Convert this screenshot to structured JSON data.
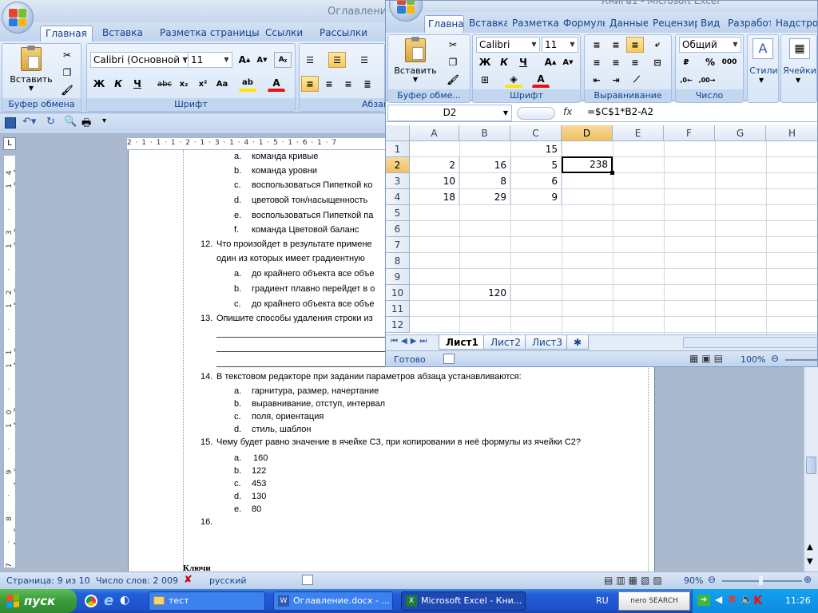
{
  "word": {
    "title": "Оглавление",
    "tabs": [
      "Главная",
      "Вставка",
      "Разметка страницы",
      "Ссылки",
      "Рассылки"
    ],
    "font_name": "Calibri (Основной те",
    "font_size": "11",
    "paste_label": "Вставить",
    "groups": {
      "clipboard": "Буфер обмена",
      "font": "Шрифт",
      "paragraph": "Абзац"
    },
    "ruler_h": "2 · 1 · 1 · 1 · 2 · 1 · 3 · 1 · 4 · 1 · 5 · 1 · 6 · 1 · 7",
    "ruler_v": "7 · 8 · 9 · 10 · 11 · 12 · 13 · 14 · 15 · 16 · 17 · 18 · 19 · 20 · 21",
    "doc": {
      "lines_top": [
        {
          "m": "a.",
          "t": "команда кривые"
        },
        {
          "m": "b.",
          "t": "команда уровни"
        },
        {
          "m": "c.",
          "t": "воспользоваться Пипеткой ко"
        },
        {
          "m": "d.",
          "t": "цветовой тон/насыщенность"
        },
        {
          "m": "e.",
          "t": "воспользоваться Пипеткой па"
        },
        {
          "m": "f.",
          "t": "команда Цветовой баланс"
        }
      ],
      "q12": "12.",
      "q12_text": "Что произойдет в результате примене",
      "q12_text2": "один из которых имеет градиентную",
      "q12_opts": [
        {
          "m": "a.",
          "t": "до крайнего объекта все объе"
        },
        {
          "m": "b.",
          "t": "градиент плавно перейдет в о"
        },
        {
          "m": "c.",
          "t": "до крайнего объекта все объе"
        }
      ],
      "q13": "13.",
      "q13_text": "Опишите способы удаления строки из",
      "q14": "14.",
      "q14_text": "В текстовом редакторе при задании параметров абзаца устанавливаются:",
      "q14_opts": [
        {
          "m": "a.",
          "t": "гарнитура, размер, начертание"
        },
        {
          "m": "b.",
          "t": "выравнивание, отступ, интервал"
        },
        {
          "m": "c.",
          "t": "поля, ориентация"
        },
        {
          "m": "d.",
          "t": "стиль, шаблон"
        }
      ],
      "q15": "15.",
      "q15_text": "Чему будет равно значение в ячейке С3, при копировании  в неё  формулы из ячейки С2?",
      "q15_opts": [
        {
          "m": "a.",
          "t": "160"
        },
        {
          "m": "b.",
          "t": "122"
        },
        {
          "m": "c.",
          "t": "453"
        },
        {
          "m": "d.",
          "t": "130"
        },
        {
          "m": "e.",
          "t": "80"
        }
      ],
      "q16": "16.",
      "keys": "Ключи"
    },
    "status": {
      "page": "Страница: 9 из 10",
      "words": "Число слов: 2 009",
      "lang": "русский",
      "zoom": "90%"
    }
  },
  "excel": {
    "title": "Книга1 - Microsoft Excel",
    "tabs": [
      "Главная",
      "Вставка",
      "Разметка с",
      "Формулы",
      "Данные",
      "Рецензир",
      "Вид",
      "Разработ",
      "Надстрой"
    ],
    "font_name": "Calibri",
    "font_size": "11",
    "number_format": "Общий",
    "paste_label": "Вставить",
    "styles_label": "Стили",
    "cells_label": "Ячейки",
    "groups": {
      "clipboard": "Буфер обме...",
      "font": "Шрифт",
      "alignment": "Выравнивание",
      "number": "Число"
    },
    "namebox": "D2",
    "fx": "fx",
    "formula": "=$C$1*B2-A2",
    "columns": [
      "A",
      "B",
      "C",
      "D",
      "E",
      "F",
      "G",
      "H"
    ],
    "rows": [
      "1",
      "2",
      "3",
      "4",
      "5",
      "6",
      "7",
      "8",
      "9",
      "10",
      "11",
      "12"
    ],
    "cells": {
      "C1": "15",
      "A2": "2",
      "B2": "16",
      "C2": "5",
      "D2": "238",
      "A3": "10",
      "B3": "8",
      "C3": "6",
      "A4": "18",
      "B4": "29",
      "C4": "9",
      "B10": "120"
    },
    "sheets": [
      "Лист1",
      "Лист2",
      "Лист3"
    ],
    "status": {
      "ready": "Готово",
      "zoom": "100%"
    }
  },
  "taskbar": {
    "start": "пуск",
    "tasks": [
      "тест",
      "Оглавление.docx - ...",
      "Microsoft Excel - Кни..."
    ],
    "lang": "RU",
    "nero": "nero SEARCH",
    "time": "11:26"
  }
}
